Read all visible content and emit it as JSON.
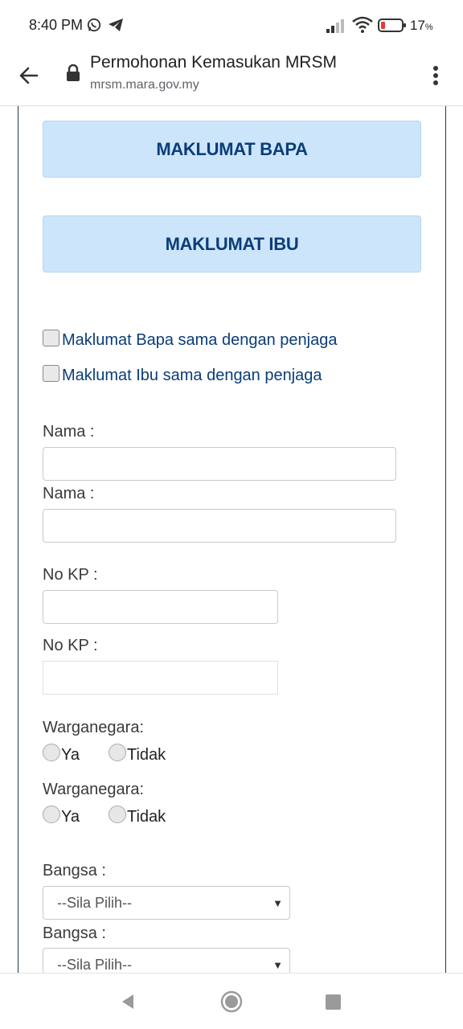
{
  "status_bar": {
    "time": "8:40 PM",
    "battery_percent": "17",
    "battery_suffix": "%",
    "icons": [
      "whatsapp-icon",
      "telegram-icon",
      "signal-icon",
      "wifi-icon",
      "battery-icon"
    ]
  },
  "browser": {
    "title": "Permohonan Kemasukan MRSM",
    "url": "mrsm.mara.gov.my"
  },
  "form": {
    "sections": {
      "bapa": "MAKLUMAT BAPA",
      "ibu": "MAKLUMAT IBU"
    },
    "checkboxes": {
      "bapa_same": "Maklumat Bapa sama dengan penjaga",
      "ibu_same": "Maklumat Ibu sama dengan penjaga"
    },
    "labels": {
      "nama": "Nama :",
      "no_kp": "No KP :",
      "warganegara": "Warganegara:",
      "bangsa": "Bangsa :"
    },
    "radio_options": {
      "ya": "Ya",
      "tidak": "Tidak"
    },
    "select_placeholder": "--Sila Pilih--"
  },
  "colors": {
    "section_bg": "#cce5fb",
    "section_text": "#0b3d78",
    "frame_border": "#1e3b43"
  }
}
